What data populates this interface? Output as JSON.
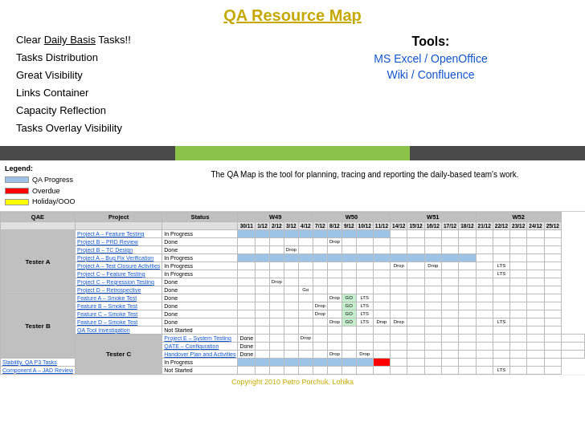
{
  "header": {
    "title": "QA Resource Map"
  },
  "features": [
    "Clear Daily Basis Tasks!!",
    "Tasks Distribution",
    "Great Visibility",
    "Links Container",
    "Capacity Reflection",
    "Tasks Overlay Visibility"
  ],
  "tools": {
    "label": "Tools:",
    "items": [
      "MS Excel / OpenOffice",
      "Wiki / Confluence"
    ]
  },
  "legend": {
    "title": "Legend:",
    "items": [
      {
        "label": "QA Progress",
        "color": "#9bc2e6"
      },
      {
        "label": "Overdue",
        "color": "#ff0000"
      },
      {
        "label": "Holiday/OOO",
        "color": "#ffff00"
      }
    ]
  },
  "description": "The QA Map is the tool for planning, tracing and reporting the daily-based team's work.",
  "weeks": [
    "W49",
    "W50",
    "W51",
    "W52"
  ],
  "footer": "Copyright 2010 Petro Porchuk, Lohika"
}
